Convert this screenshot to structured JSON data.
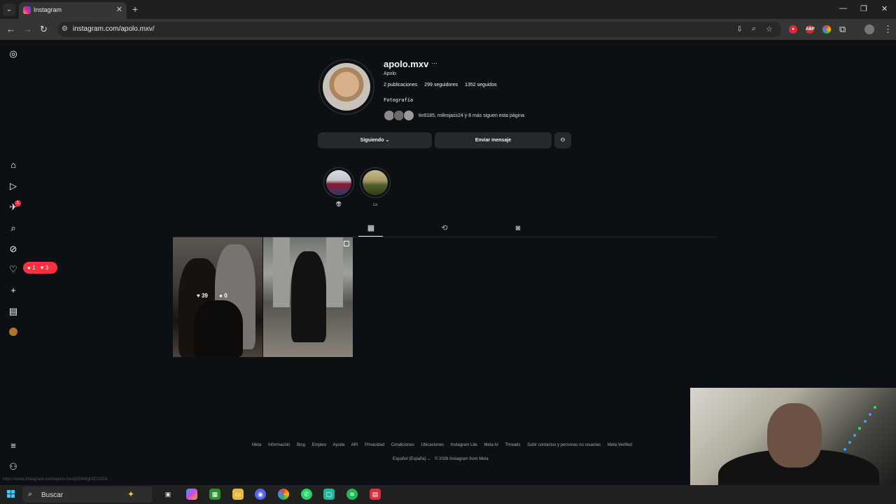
{
  "browser": {
    "tab_title": "Instagram",
    "url": "instagram.com/apolo.mxv/"
  },
  "profile": {
    "username": "apolo.mxv",
    "full_name": "Apolo",
    "stats": {
      "posts": "2 publicaciones",
      "followers": "299 seguidores",
      "following": "1352 seguidos"
    },
    "bio": "Fotografía",
    "followed_by": "tin9185, milirojass24 y 8 más siguen esta página",
    "following_button": "Siguiendo",
    "message_button": "Enviar mensaje"
  },
  "highlights": [
    {
      "label": ""
    },
    {
      "label": ""
    }
  ],
  "nav": {
    "notif_badge": "1",
    "activity_pill": {
      "comments": "1",
      "likes": "3"
    }
  },
  "posts": [
    {
      "likes": "39",
      "comments": "0"
    },
    {
      "likes": "",
      "comments": ""
    }
  ],
  "footer": {
    "links": [
      "Meta",
      "Información",
      "Blog",
      "Empleo",
      "Ayuda",
      "API",
      "Privacidad",
      "Condiciones",
      "Ubicaciones",
      "Instagram Lite",
      "Meta AI",
      "Threads",
      "Subir contactos y personas no usuarias",
      "Meta Verified"
    ],
    "language": "Español (España)",
    "copyright": "© 2026 Instagram from Meta"
  },
  "status_bar_url": "https://www.instagram.com/apolo.mxv/p/DW4gUtC01E4/",
  "taskbar": {
    "search_placeholder": "Buscar"
  }
}
